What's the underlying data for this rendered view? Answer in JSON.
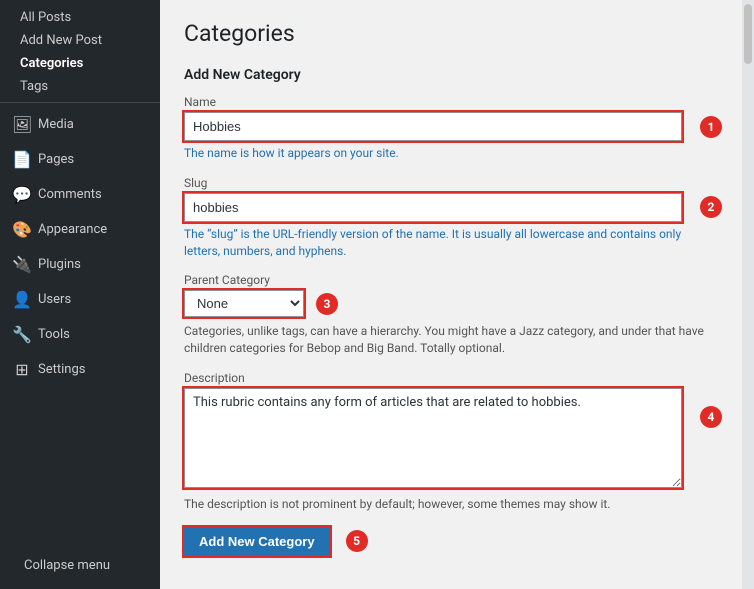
{
  "sidebar": {
    "links_top": [
      {
        "label": "All Posts",
        "active": false
      },
      {
        "label": "Add New Post",
        "active": false
      },
      {
        "label": "Categories",
        "active": true
      },
      {
        "label": "Tags",
        "active": false
      }
    ],
    "sections": [
      {
        "icon": "🖼",
        "label": "Media"
      },
      {
        "icon": "📄",
        "label": "Pages"
      },
      {
        "icon": "💬",
        "label": "Comments"
      },
      {
        "icon": "🎨",
        "label": "Appearance"
      },
      {
        "icon": "🔌",
        "label": "Plugins"
      },
      {
        "icon": "👤",
        "label": "Users"
      },
      {
        "icon": "🔧",
        "label": "Tools"
      },
      {
        "icon": "⚙",
        "label": "Settings"
      }
    ],
    "collapse_label": "Collapse menu"
  },
  "page": {
    "title": "Categories",
    "form_title": "Add New Category",
    "fields": {
      "name": {
        "label": "Name",
        "value": "Hobbies",
        "hint": "The name is how it appears on your site."
      },
      "slug": {
        "label": "Slug",
        "value": "hobbies",
        "hint": "The “slug” is the URL-friendly version of the name. It is usually all lowercase and contains only letters, numbers, and hyphens."
      },
      "parent_category": {
        "label": "Parent Category",
        "value": "None",
        "hint": "Categories, unlike tags, can have a hierarchy. You might have a Jazz category, and under that have children categories for Bebop and Big Band. Totally optional."
      },
      "description": {
        "label": "Description",
        "value": "This rubric contains any form of articles that are related to hobbies.",
        "hint": "The description is not prominent by default; however, some themes may show it."
      }
    },
    "submit_button": "Add New Category",
    "badge_labels": [
      "1",
      "2",
      "3",
      "4",
      "5"
    ]
  }
}
